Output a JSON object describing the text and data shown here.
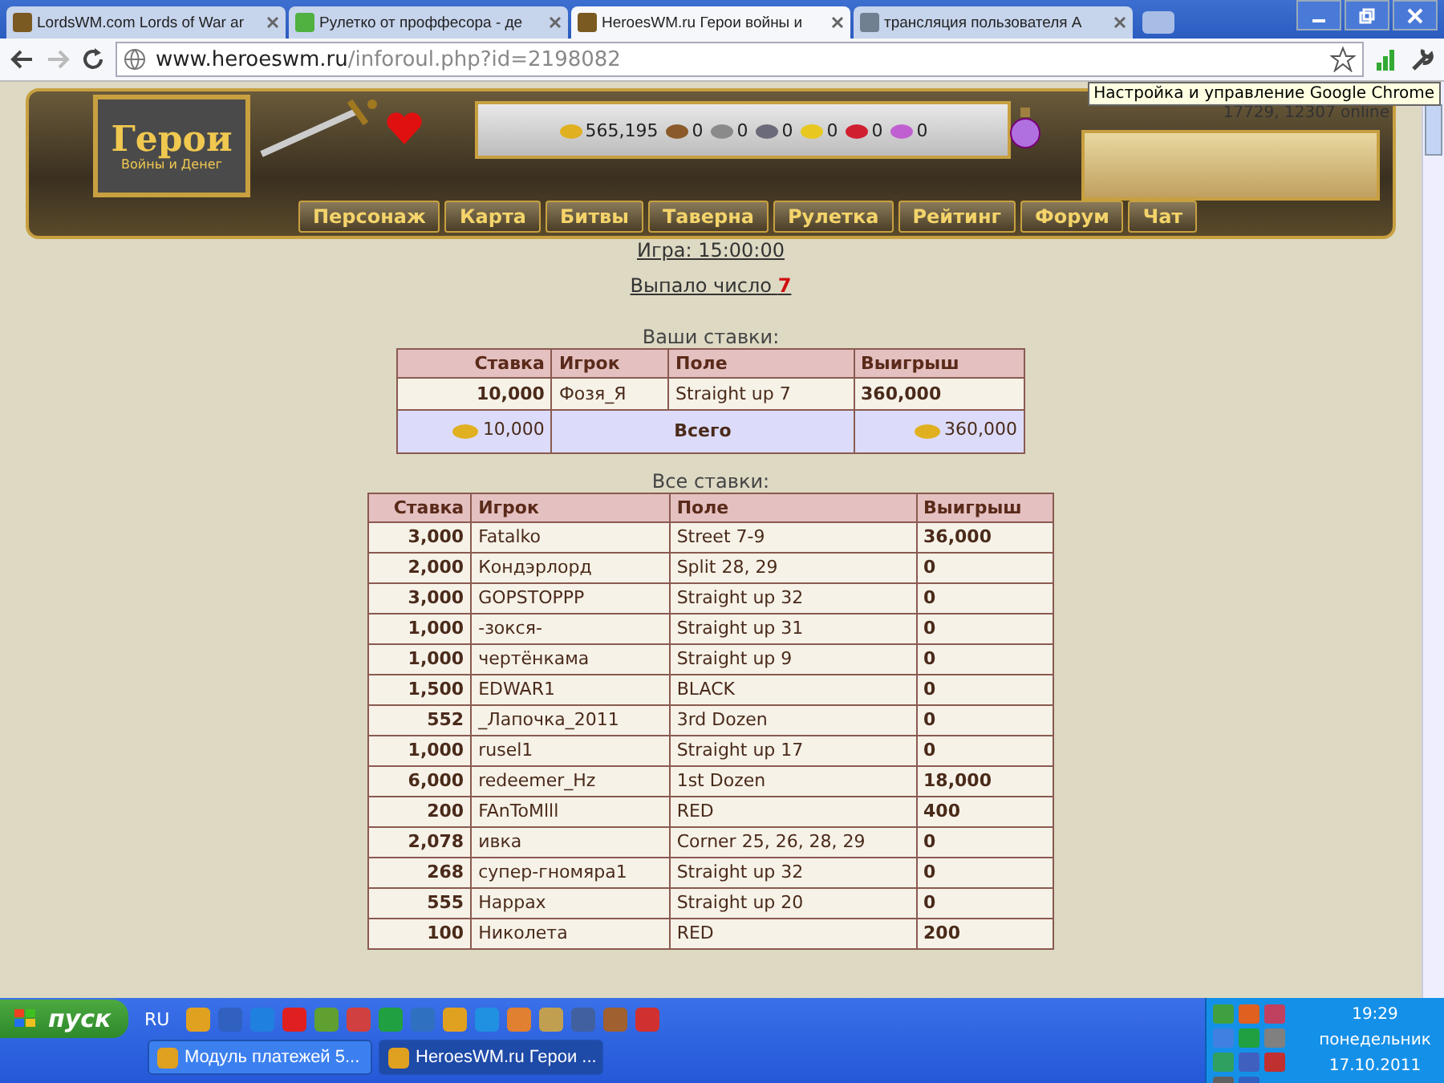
{
  "browser": {
    "tabs": [
      {
        "title": "LordsWM.com Lords of War ar",
        "selected": false
      },
      {
        "title": "Рулетко от проффесора - де",
        "selected": false
      },
      {
        "title": "HeroesWM.ru Герои войны и",
        "selected": true
      },
      {
        "title": "трансляция пользователя A",
        "selected": false
      }
    ],
    "address": {
      "host": "www.heroeswm.ru",
      "path": "/inforoul.php?id=2198082"
    },
    "tooltip": "Настройка и управление Google Chrome"
  },
  "header": {
    "logo": {
      "title": "Герои",
      "subtitle": "Войны и Денег"
    },
    "resources": [
      {
        "kind": "gold",
        "value": "565,195"
      },
      {
        "kind": "wood",
        "value": "0"
      },
      {
        "kind": "ore",
        "value": "0"
      },
      {
        "kind": "mercury",
        "value": "0"
      },
      {
        "kind": "sulfur",
        "value": "0"
      },
      {
        "kind": "crystal",
        "value": "0"
      },
      {
        "kind": "gems",
        "value": "0"
      }
    ],
    "online": "17729, 12307 online",
    "nav": [
      "Персонаж",
      "Карта",
      "Битвы",
      "Таверна",
      "Рулетка",
      "Рейтинг",
      "Форум",
      "Чат"
    ]
  },
  "game": {
    "time_link": "Игра: 15:00:00",
    "result_label": "Выпало число",
    "result_number": "7"
  },
  "your_bets": {
    "title": "Ваши ставки:",
    "columns": [
      "Ставка",
      "Игрок",
      "Поле",
      "Выигрыш"
    ],
    "rows": [
      {
        "stake": "10,000",
        "player": "Фозя_Я",
        "field": "Straight up 7",
        "win": "360,000"
      }
    ],
    "total": {
      "stake": "10,000",
      "label": "Всего",
      "win": "360,000"
    }
  },
  "all_bets": {
    "title": "Все ставки:",
    "columns": [
      "Ставка",
      "Игрок",
      "Поле",
      "Выигрыш"
    ],
    "rows": [
      {
        "stake": "3,000",
        "player": "Fatalko",
        "field": "Street 7-9",
        "win": "36,000"
      },
      {
        "stake": "2,000",
        "player": "Кондэрлорд",
        "field": "Split 28, 29",
        "win": "0"
      },
      {
        "stake": "3,000",
        "player": "GOPSTOPPP",
        "field": "Straight up 32",
        "win": "0"
      },
      {
        "stake": "1,000",
        "player": "-зокся-",
        "field": "Straight up 31",
        "win": "0"
      },
      {
        "stake": "1,000",
        "player": "чертёнкама",
        "field": "Straight up 9",
        "win": "0"
      },
      {
        "stake": "1,500",
        "player": "EDWAR1",
        "field": "BLACK",
        "win": "0"
      },
      {
        "stake": "552",
        "player": "_Лапочка_2011",
        "field": "3rd Dozen",
        "win": "0"
      },
      {
        "stake": "1,000",
        "player": "rusel1",
        "field": "Straight up 17",
        "win": "0"
      },
      {
        "stake": "6,000",
        "player": "redeemer_Hz",
        "field": "1st Dozen",
        "win": "18,000"
      },
      {
        "stake": "200",
        "player": "FAnToMlll",
        "field": "RED",
        "win": "400"
      },
      {
        "stake": "2,078",
        "player": "ивка",
        "field": "Corner 25, 26, 28, 29",
        "win": "0"
      },
      {
        "stake": "268",
        "player": "супер-гномяра1",
        "field": "Straight up 32",
        "win": "0"
      },
      {
        "stake": "555",
        "player": "Happax",
        "field": "Straight up 20",
        "win": "0"
      },
      {
        "stake": "100",
        "player": "Николета",
        "field": "RED",
        "win": "200"
      }
    ]
  },
  "taskbar": {
    "start": "пуск",
    "language": "RU",
    "tasks": [
      {
        "title": "Модуль платежей 5...",
        "selected": false
      },
      {
        "title": "HeroesWM.ru Герои ...",
        "selected": true
      }
    ],
    "clock": {
      "time": "19:29",
      "day": "понедельник",
      "date": "17.10.2011"
    }
  }
}
